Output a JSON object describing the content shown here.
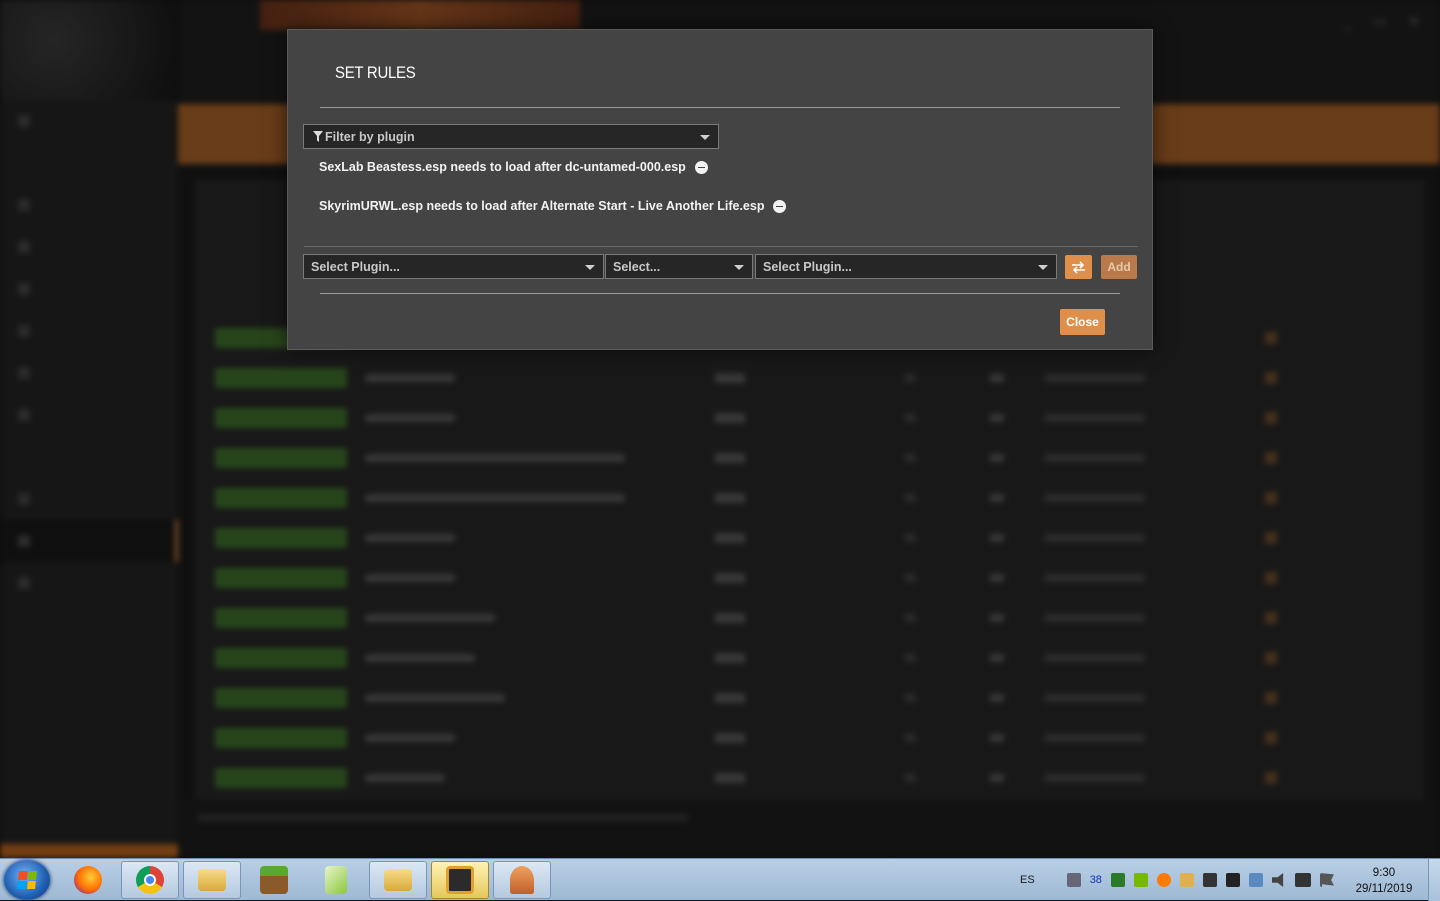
{
  "modal": {
    "title": "SET RULES",
    "filter": {
      "placeholder": "Filter by plugin"
    },
    "rules": [
      {
        "text": "SexLab Beastess.esp needs to load after dc-untamed-000.esp",
        "remove_icon": "minus-circle-icon"
      },
      {
        "text": "SkyrimURWL.esp needs to load after Alternate Start - Live Another Life.esp",
        "remove_icon": "minus-circle-icon"
      }
    ],
    "new_rule": {
      "plugin_a_placeholder": "Select Plugin...",
      "type_placeholder": "Select...",
      "plugin_b_placeholder": "Select Plugin...",
      "swap_icon": "swap-arrows-icon",
      "add_label": "Add"
    },
    "close_label": "Close"
  },
  "taskbar": {
    "apps": [
      "firefox-icon",
      "chrome-icon",
      "file-explorer-icon",
      "minecraft-icon",
      "notepad-icon",
      "file-explorer-icon",
      "mod-manager-icon",
      "tornado-app-icon"
    ],
    "tray": {
      "language": "ES",
      "badge": "38"
    },
    "clock": {
      "time": "9:30",
      "date": "29/11/2019"
    }
  },
  "colors": {
    "accent": "#e08f4a",
    "modal_bg": "#444444",
    "combo_bg": "#262626"
  }
}
